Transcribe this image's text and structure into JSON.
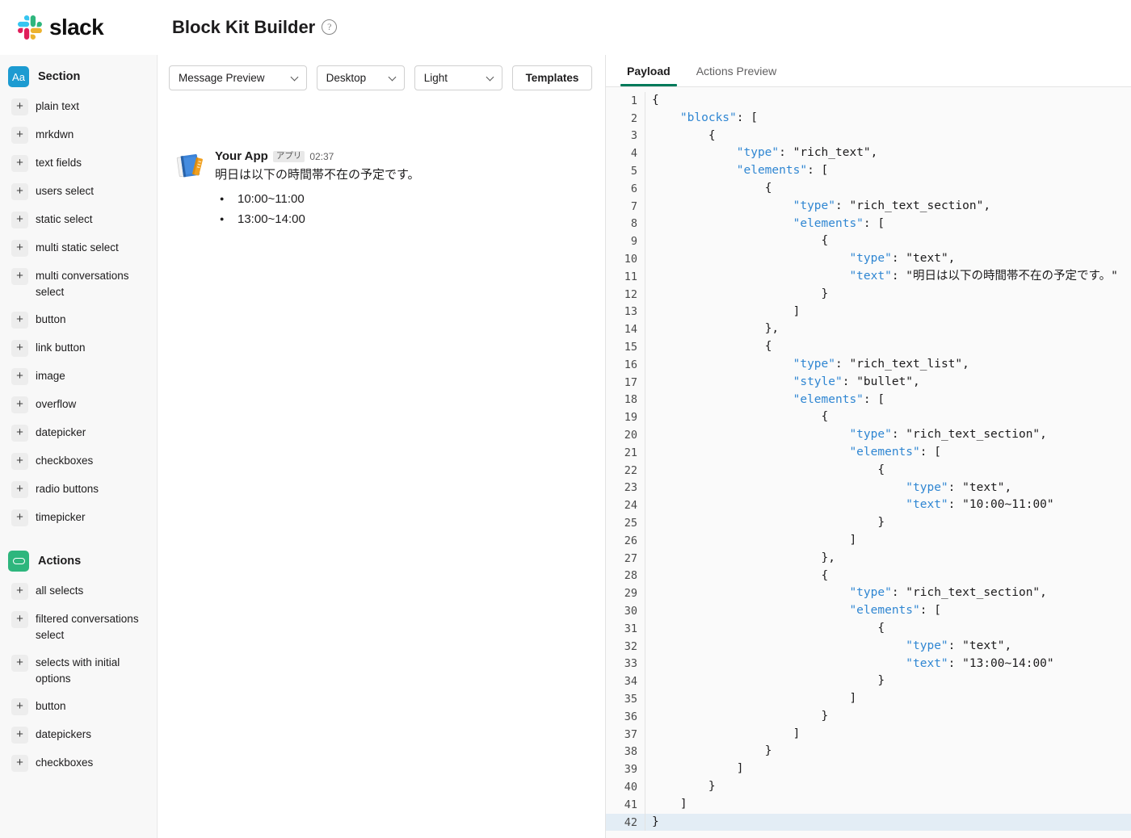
{
  "header": {
    "logo_text": "slack",
    "logo_icon": "slack-logo-icon",
    "title": "Block Kit Builder",
    "help_icon": "question-mark-circle-icon",
    "help_glyph": "?"
  },
  "sidebar": {
    "groups": [
      {
        "name": "Section",
        "icon": "aa-text-icon",
        "icon_label": "Aa",
        "icon_color": "#1d9bd1",
        "items": [
          {
            "label": "plain text",
            "add_icon": "plus-icon"
          },
          {
            "label": "mrkdwn",
            "add_icon": "plus-icon"
          },
          {
            "label": "text fields",
            "add_icon": "plus-icon"
          },
          {
            "label": "users select",
            "add_icon": "plus-icon"
          },
          {
            "label": "static select",
            "add_icon": "plus-icon"
          },
          {
            "label": "multi static select",
            "add_icon": "plus-icon"
          },
          {
            "label": "multi conversations select",
            "add_icon": "plus-icon"
          },
          {
            "label": "button",
            "add_icon": "plus-icon"
          },
          {
            "label": "link button",
            "add_icon": "plus-icon"
          },
          {
            "label": "image",
            "add_icon": "plus-icon"
          },
          {
            "label": "overflow",
            "add_icon": "plus-icon"
          },
          {
            "label": "datepicker",
            "add_icon": "plus-icon"
          },
          {
            "label": "checkboxes",
            "add_icon": "plus-icon"
          },
          {
            "label": "radio buttons",
            "add_icon": "plus-icon"
          },
          {
            "label": "timepicker",
            "add_icon": "plus-icon"
          }
        ]
      },
      {
        "name": "Actions",
        "icon": "actions-pill-icon",
        "icon_label": "",
        "icon_color": "#2eb67d",
        "items": [
          {
            "label": "all selects",
            "add_icon": "plus-icon"
          },
          {
            "label": "filtered conversations select",
            "add_icon": "plus-icon"
          },
          {
            "label": "selects with initial options",
            "add_icon": "plus-icon"
          },
          {
            "label": "button",
            "add_icon": "plus-icon"
          },
          {
            "label": "datepickers",
            "add_icon": "plus-icon"
          },
          {
            "label": "checkboxes",
            "add_icon": "plus-icon"
          }
        ]
      }
    ]
  },
  "toolbar": {
    "mode_select": {
      "value": "Message Preview",
      "chevron": "chevron-down-icon"
    },
    "surface_select": {
      "value": "Desktop",
      "chevron": "chevron-down-icon"
    },
    "theme_select": {
      "value": "Light",
      "chevron": "chevron-down-icon"
    },
    "templates_label": "Templates"
  },
  "preview": {
    "avatar_icon": "notebooks-emoji-icon",
    "author": "Your App",
    "badge": "アプリ",
    "time": "02:37",
    "text": "明日は以下の時間帯不在の予定です。",
    "bullets": [
      "10:00~11:00",
      "13:00~14:00"
    ]
  },
  "payload_panel": {
    "tabs": [
      {
        "label": "Payload",
        "active": true
      },
      {
        "label": "Actions Preview",
        "active": false
      }
    ],
    "active_tab_accent": "#007a5a",
    "highlighted_line": 42,
    "lines": [
      {
        "n": 1,
        "indent": 0,
        "tokens": [
          {
            "t": "p",
            "v": "{"
          }
        ]
      },
      {
        "n": 2,
        "indent": 1,
        "tokens": [
          {
            "t": "k",
            "v": "\"blocks\""
          },
          {
            "t": "p",
            "v": ": ["
          }
        ]
      },
      {
        "n": 3,
        "indent": 2,
        "tokens": [
          {
            "t": "p",
            "v": "{"
          }
        ]
      },
      {
        "n": 4,
        "indent": 3,
        "tokens": [
          {
            "t": "k",
            "v": "\"type\""
          },
          {
            "t": "p",
            "v": ": "
          },
          {
            "t": "s",
            "v": "\"rich_text\","
          }
        ]
      },
      {
        "n": 5,
        "indent": 3,
        "tokens": [
          {
            "t": "k",
            "v": "\"elements\""
          },
          {
            "t": "p",
            "v": ": ["
          }
        ]
      },
      {
        "n": 6,
        "indent": 4,
        "tokens": [
          {
            "t": "p",
            "v": "{"
          }
        ]
      },
      {
        "n": 7,
        "indent": 5,
        "tokens": [
          {
            "t": "k",
            "v": "\"type\""
          },
          {
            "t": "p",
            "v": ": "
          },
          {
            "t": "s",
            "v": "\"rich_text_section\","
          }
        ]
      },
      {
        "n": 8,
        "indent": 5,
        "tokens": [
          {
            "t": "k",
            "v": "\"elements\""
          },
          {
            "t": "p",
            "v": ": ["
          }
        ]
      },
      {
        "n": 9,
        "indent": 6,
        "tokens": [
          {
            "t": "p",
            "v": "{"
          }
        ]
      },
      {
        "n": 10,
        "indent": 7,
        "tokens": [
          {
            "t": "k",
            "v": "\"type\""
          },
          {
            "t": "p",
            "v": ": "
          },
          {
            "t": "s",
            "v": "\"text\","
          }
        ]
      },
      {
        "n": 11,
        "indent": 7,
        "tokens": [
          {
            "t": "k",
            "v": "\"text\""
          },
          {
            "t": "p",
            "v": ": "
          },
          {
            "t": "s",
            "v": "\"明日は以下の時間帯不在の予定です。\""
          }
        ]
      },
      {
        "n": 12,
        "indent": 6,
        "tokens": [
          {
            "t": "p",
            "v": "}"
          }
        ]
      },
      {
        "n": 13,
        "indent": 5,
        "tokens": [
          {
            "t": "p",
            "v": "]"
          }
        ]
      },
      {
        "n": 14,
        "indent": 4,
        "tokens": [
          {
            "t": "p",
            "v": "},"
          }
        ]
      },
      {
        "n": 15,
        "indent": 4,
        "tokens": [
          {
            "t": "p",
            "v": "{"
          }
        ]
      },
      {
        "n": 16,
        "indent": 5,
        "tokens": [
          {
            "t": "k",
            "v": "\"type\""
          },
          {
            "t": "p",
            "v": ": "
          },
          {
            "t": "s",
            "v": "\"rich_text_list\","
          }
        ]
      },
      {
        "n": 17,
        "indent": 5,
        "tokens": [
          {
            "t": "k",
            "v": "\"style\""
          },
          {
            "t": "p",
            "v": ": "
          },
          {
            "t": "s",
            "v": "\"bullet\","
          }
        ]
      },
      {
        "n": 18,
        "indent": 5,
        "tokens": [
          {
            "t": "k",
            "v": "\"elements\""
          },
          {
            "t": "p",
            "v": ": ["
          }
        ]
      },
      {
        "n": 19,
        "indent": 6,
        "tokens": [
          {
            "t": "p",
            "v": "{"
          }
        ]
      },
      {
        "n": 20,
        "indent": 7,
        "tokens": [
          {
            "t": "k",
            "v": "\"type\""
          },
          {
            "t": "p",
            "v": ": "
          },
          {
            "t": "s",
            "v": "\"rich_text_section\","
          }
        ]
      },
      {
        "n": 21,
        "indent": 7,
        "tokens": [
          {
            "t": "k",
            "v": "\"elements\""
          },
          {
            "t": "p",
            "v": ": ["
          }
        ]
      },
      {
        "n": 22,
        "indent": 8,
        "tokens": [
          {
            "t": "p",
            "v": "{"
          }
        ]
      },
      {
        "n": 23,
        "indent": 9,
        "tokens": [
          {
            "t": "k",
            "v": "\"type\""
          },
          {
            "t": "p",
            "v": ": "
          },
          {
            "t": "s",
            "v": "\"text\","
          }
        ]
      },
      {
        "n": 24,
        "indent": 9,
        "tokens": [
          {
            "t": "k",
            "v": "\"text\""
          },
          {
            "t": "p",
            "v": ": "
          },
          {
            "t": "s",
            "v": "\"10:00~11:00\""
          }
        ]
      },
      {
        "n": 25,
        "indent": 8,
        "tokens": [
          {
            "t": "p",
            "v": "}"
          }
        ]
      },
      {
        "n": 26,
        "indent": 7,
        "tokens": [
          {
            "t": "p",
            "v": "]"
          }
        ]
      },
      {
        "n": 27,
        "indent": 6,
        "tokens": [
          {
            "t": "p",
            "v": "},"
          }
        ]
      },
      {
        "n": 28,
        "indent": 6,
        "tokens": [
          {
            "t": "p",
            "v": "{"
          }
        ]
      },
      {
        "n": 29,
        "indent": 7,
        "tokens": [
          {
            "t": "k",
            "v": "\"type\""
          },
          {
            "t": "p",
            "v": ": "
          },
          {
            "t": "s",
            "v": "\"rich_text_section\","
          }
        ]
      },
      {
        "n": 30,
        "indent": 7,
        "tokens": [
          {
            "t": "k",
            "v": "\"elements\""
          },
          {
            "t": "p",
            "v": ": ["
          }
        ]
      },
      {
        "n": 31,
        "indent": 8,
        "tokens": [
          {
            "t": "p",
            "v": "{"
          }
        ]
      },
      {
        "n": 32,
        "indent": 9,
        "tokens": [
          {
            "t": "k",
            "v": "\"type\""
          },
          {
            "t": "p",
            "v": ": "
          },
          {
            "t": "s",
            "v": "\"text\","
          }
        ]
      },
      {
        "n": 33,
        "indent": 9,
        "tokens": [
          {
            "t": "k",
            "v": "\"text\""
          },
          {
            "t": "p",
            "v": ": "
          },
          {
            "t": "s",
            "v": "\"13:00~14:00\""
          }
        ]
      },
      {
        "n": 34,
        "indent": 8,
        "tokens": [
          {
            "t": "p",
            "v": "}"
          }
        ]
      },
      {
        "n": 35,
        "indent": 7,
        "tokens": [
          {
            "t": "p",
            "v": "]"
          }
        ]
      },
      {
        "n": 36,
        "indent": 6,
        "tokens": [
          {
            "t": "p",
            "v": "}"
          }
        ]
      },
      {
        "n": 37,
        "indent": 5,
        "tokens": [
          {
            "t": "p",
            "v": "]"
          }
        ]
      },
      {
        "n": 38,
        "indent": 4,
        "tokens": [
          {
            "t": "p",
            "v": "}"
          }
        ]
      },
      {
        "n": 39,
        "indent": 3,
        "tokens": [
          {
            "t": "p",
            "v": "]"
          }
        ]
      },
      {
        "n": 40,
        "indent": 2,
        "tokens": [
          {
            "t": "p",
            "v": "}"
          }
        ]
      },
      {
        "n": 41,
        "indent": 1,
        "tokens": [
          {
            "t": "p",
            "v": "]"
          }
        ]
      },
      {
        "n": 42,
        "indent": 0,
        "tokens": [
          {
            "t": "p",
            "v": "}"
          }
        ]
      }
    ]
  }
}
